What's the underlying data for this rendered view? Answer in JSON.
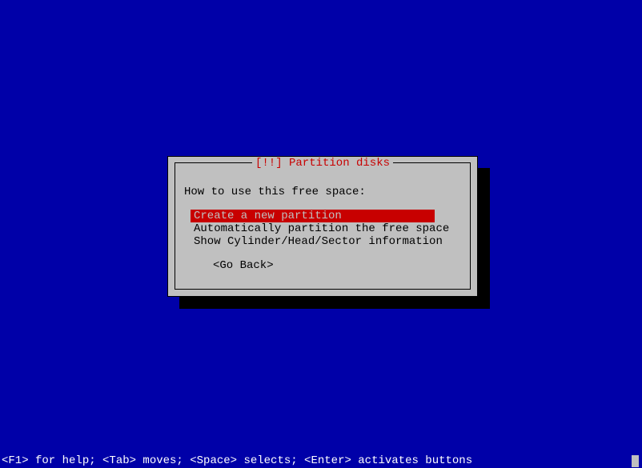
{
  "dialog": {
    "title": "[!!] Partition disks",
    "prompt": "How to use this free space:",
    "options": [
      "Create a new partition",
      "Automatically partition the free space",
      "Show Cylinder/Head/Sector information"
    ],
    "go_back": "<Go Back>"
  },
  "status_bar": "<F1> for help; <Tab> moves; <Space> selects; <Enter> activates buttons"
}
